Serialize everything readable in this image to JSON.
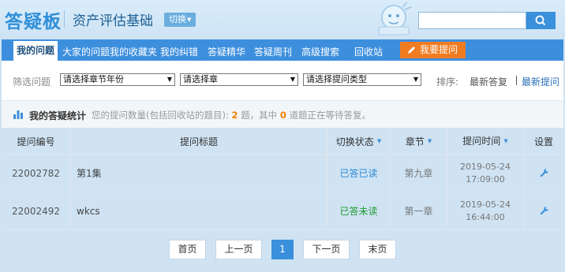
{
  "header": {
    "logo": "答疑板",
    "subject": "资产评估基础",
    "switch_label": "切换"
  },
  "search": {
    "placeholder": ""
  },
  "tabs": [
    {
      "label": "我的问题",
      "active": true
    },
    {
      "label": "大家的问题"
    },
    {
      "label": "我的收藏夹"
    },
    {
      "label": "我的纠错"
    },
    {
      "label": "答疑精华"
    },
    {
      "label": "答疑周刊"
    },
    {
      "label": "高级搜索"
    },
    {
      "label": "回收站"
    }
  ],
  "ask_button": "我要提问",
  "filters": {
    "label": "筛选问题",
    "select_year": "请选择章节年份",
    "select_chapter": "请选择章",
    "select_type": "请选择提问类型",
    "sort_label": "排序:",
    "sort_latest_answer": "最新答复",
    "sort_latest_question": "最新提问"
  },
  "stats": {
    "title": "我的答疑统计",
    "prefix": "您的提问数量(包括回收站的题目):",
    "count": "2",
    "middle": "题，其中",
    "waiting": "0",
    "suffix": "道题正在等待答复。"
  },
  "table": {
    "headers": {
      "id": "提问编号",
      "title": "提问标题",
      "status": "切换状态",
      "chapter": "章节",
      "time": "提问时间",
      "settings": "设置"
    },
    "rows": [
      {
        "id": "22002782",
        "title": "第1集",
        "status": "已答已读",
        "chapter": "第九章",
        "date": "2019-05-24",
        "time": "17:09:00"
      },
      {
        "id": "22002492",
        "title": "wkcs",
        "status": "已答未读",
        "chapter": "第一章",
        "date": "2019-05-24",
        "time": "16:44:00"
      }
    ]
  },
  "pagination": {
    "first": "首页",
    "prev": "上一页",
    "current": "1",
    "next": "下一页",
    "last": "末页"
  },
  "colors": {
    "tab_bar": "#3d8fde",
    "ask_button": "#f07c22",
    "status_read": "#2a8ad6",
    "status_unread": "#1f9a2f"
  }
}
